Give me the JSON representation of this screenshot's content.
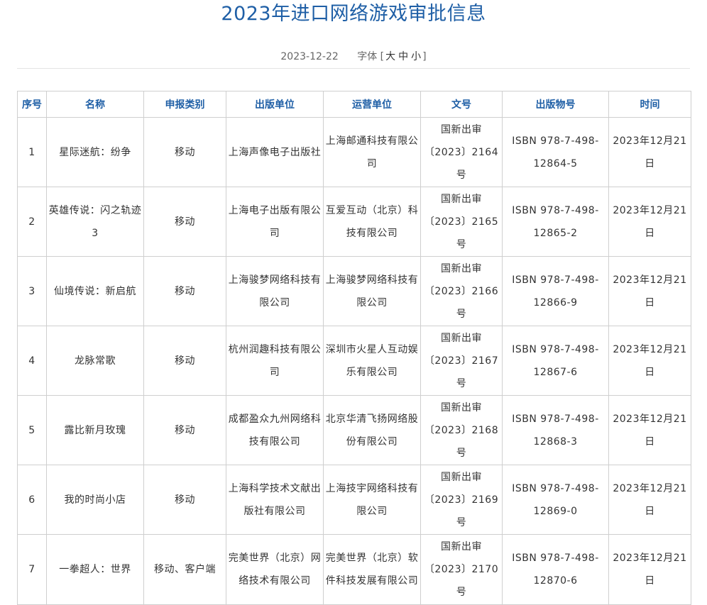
{
  "page": {
    "title": "2023年进口网络游戏审批信息",
    "date": "2023-12-22",
    "font_size_label": "字体",
    "font_size_open": "[",
    "font_sizes": [
      "大",
      "中",
      "小"
    ],
    "font_size_close": "]"
  },
  "table": {
    "headers": [
      "序号",
      "名称",
      "申报类别",
      "出版单位",
      "运营单位",
      "文号",
      "出版物号",
      "时间"
    ],
    "rows": [
      {
        "no": "1",
        "name": "星际迷航：纷争",
        "category": "移动",
        "publisher": "上海声像电子出版社",
        "operator": "上海邮通科技有限公司",
        "doc": "国新出审〔2023〕2164号",
        "isbn": "ISBN 978-7-498-12864-5",
        "date": "2023年12月21日"
      },
      {
        "no": "2",
        "name": "英雄传说：闪之轨迹3",
        "category": "移动",
        "publisher": "上海电子出版有限公司",
        "operator": "互爱互动（北京）科技有限公司",
        "doc": "国新出审〔2023〕2165号",
        "isbn": "ISBN 978-7-498-12865-2",
        "date": "2023年12月21日"
      },
      {
        "no": "3",
        "name": "仙境传说：新启航",
        "category": "移动",
        "publisher": "上海骏梦网络科技有限公司",
        "operator": "上海骏梦网络科技有限公司",
        "doc": "国新出审〔2023〕2166号",
        "isbn": "ISBN 978-7-498-12866-9",
        "date": "2023年12月21日"
      },
      {
        "no": "4",
        "name": "龙脉常歌",
        "category": "移动",
        "publisher": "杭州润趣科技有限公司",
        "operator": "深圳市火星人互动娱乐有限公司",
        "doc": "国新出审〔2023〕2167号",
        "isbn": "ISBN 978-7-498-12867-6",
        "date": "2023年12月21日"
      },
      {
        "no": "5",
        "name": "露比新月玫瑰",
        "category": "移动",
        "publisher": "成都盈众九州网络科技有限公司",
        "operator": "北京华清飞扬网络股份有限公司",
        "doc": "国新出审〔2023〕2168号",
        "isbn": "ISBN 978-7-498-12868-3",
        "date": "2023年12月21日"
      },
      {
        "no": "6",
        "name": "我的时尚小店",
        "category": "移动",
        "publisher": "上海科学技术文献出版社有限公司",
        "operator": "上海技宇网络科技有限公司",
        "doc": "国新出审〔2023〕2169号",
        "isbn": "ISBN 978-7-498-12869-0",
        "date": "2023年12月21日"
      },
      {
        "no": "7",
        "name": "一拳超人：世界",
        "category": "移动、客户端",
        "publisher": "完美世界（北京）网络技术有限公司",
        "operator": "完美世界（北京）软件科技发展有限公司",
        "doc": "国新出审〔2023〕2170号",
        "isbn": "ISBN 978-7-498-12870-6",
        "date": "2023年12月21日"
      }
    ]
  }
}
